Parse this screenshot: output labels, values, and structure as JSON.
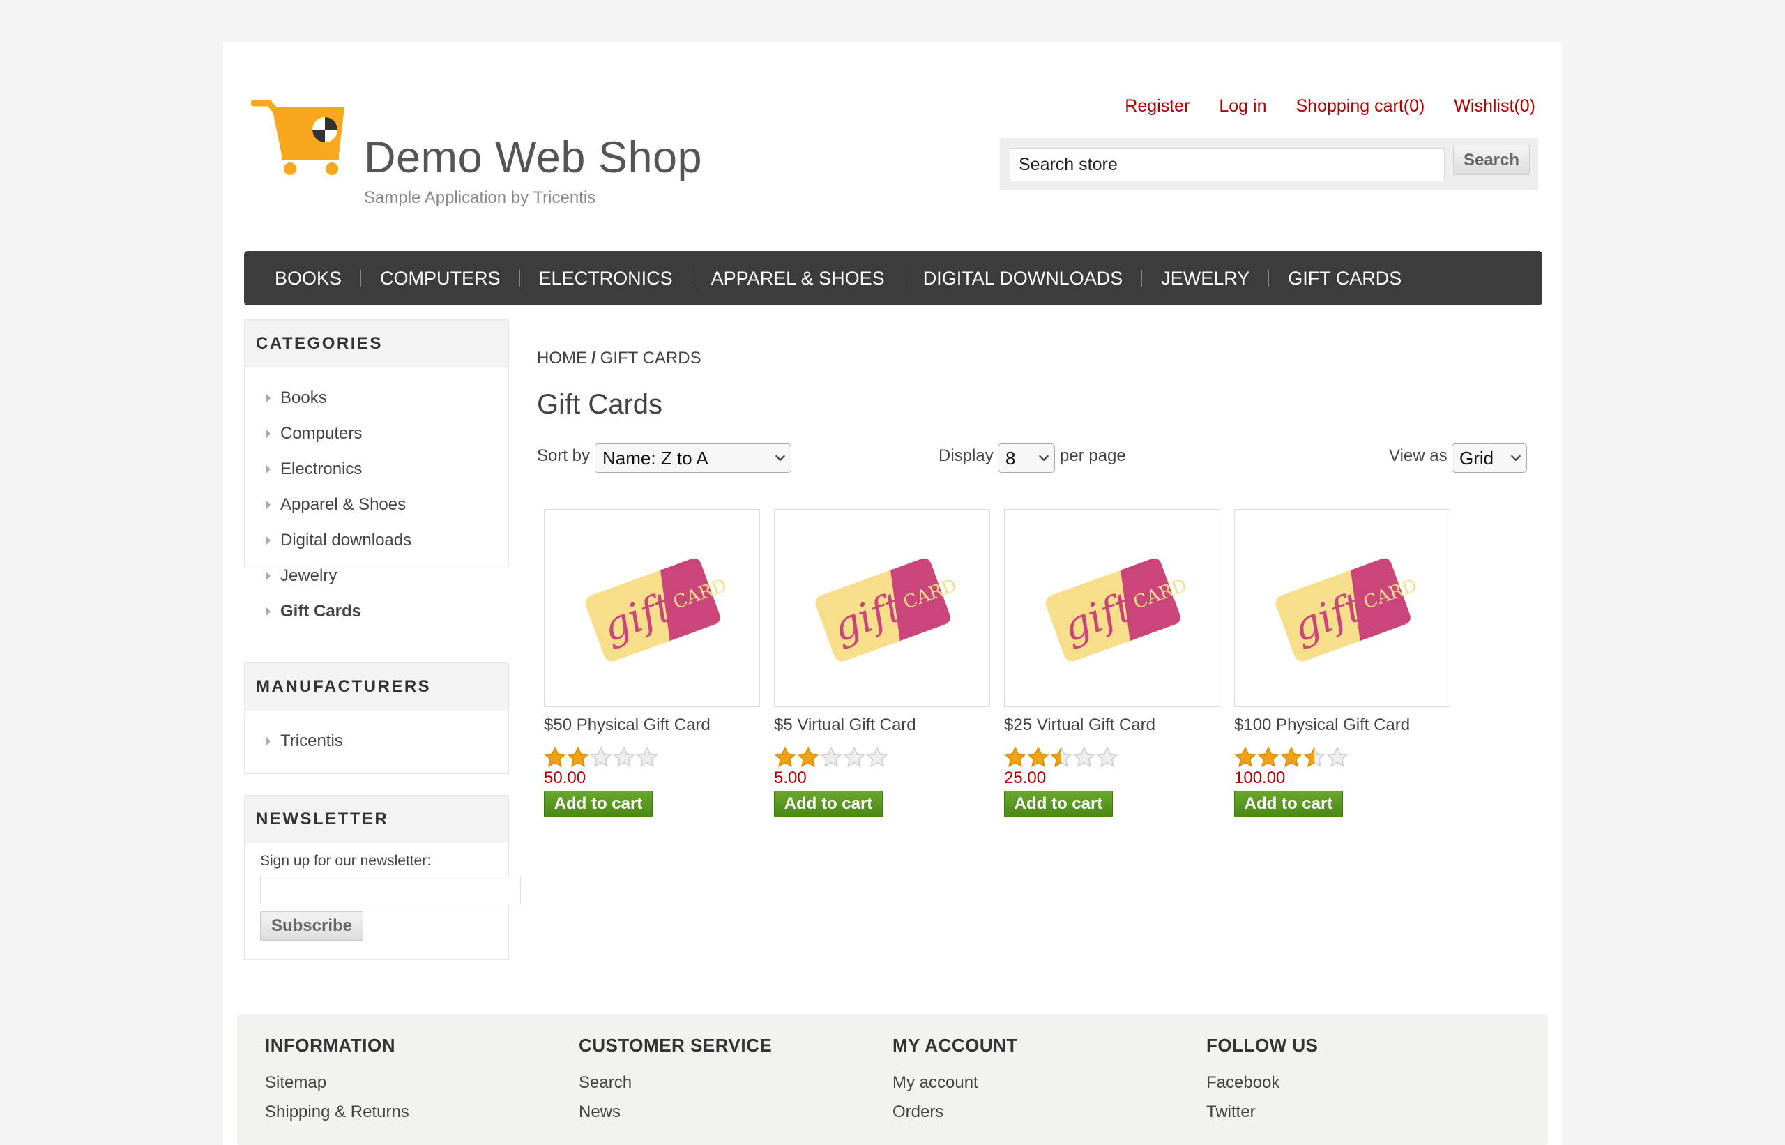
{
  "header": {
    "title": "Demo Web Shop",
    "subtitle": "Sample Application by Tricentis",
    "links": [
      "Register",
      "Log in",
      "Shopping cart(0)",
      "Wishlist(0)"
    ],
    "search_value": "Search store",
    "search_button": "Search",
    "accent_color": "#b00000",
    "logo_color": "#f8a81c"
  },
  "menu": [
    "BOOKS",
    "COMPUTERS",
    "ELECTRONICS",
    "APPAREL & SHOES",
    "DIGITAL DOWNLOADS",
    "JEWELRY",
    "GIFT CARDS"
  ],
  "sidebar": {
    "categories_title": "CATEGORIES",
    "categories": [
      "Books",
      "Computers",
      "Electronics",
      "Apparel & Shoes",
      "Digital downloads",
      "Jewelry",
      "Gift Cards"
    ],
    "manufacturers_title": "MANUFACTURERS",
    "manufacturers": [
      "Tricentis"
    ],
    "newsletter_title": "NEWSLETTER",
    "newsletter_label": "Sign up for our newsletter:",
    "subscribe_button": "Subscribe"
  },
  "main": {
    "breadcrumb_home": "HOME",
    "breadcrumb_sep": "/",
    "breadcrumb_current": "GIFT CARDS",
    "title": "Gift Cards",
    "sort_label": "Sort by",
    "sort_value": "Name: Z to A",
    "display_label": "Display",
    "display_value": "8",
    "per_page_label": "per page",
    "view_label": "View as",
    "view_value": "Grid"
  },
  "products": [
    {
      "name": "$50 Physical Gift Card",
      "price": "50.00",
      "rating": 2,
      "button": "Add to cart"
    },
    {
      "name": "$5 Virtual Gift Card",
      "price": "5.00",
      "rating": 2,
      "button": "Add to cart"
    },
    {
      "name": "$25 Virtual Gift Card",
      "price": "25.00",
      "rating": 2.5,
      "button": "Add to cart"
    },
    {
      "name": "$100 Physical Gift Card",
      "price": "100.00",
      "rating": 3.5,
      "button": "Add to cart"
    }
  ],
  "footer": [
    {
      "title": "INFORMATION",
      "links": [
        "Sitemap",
        "Shipping & Returns"
      ]
    },
    {
      "title": "CUSTOMER SERVICE",
      "links": [
        "Search",
        "News"
      ]
    },
    {
      "title": "MY ACCOUNT",
      "links": [
        "My account",
        "Orders"
      ]
    },
    {
      "title": "FOLLOW US",
      "links": [
        "Facebook",
        "Twitter"
      ]
    }
  ]
}
